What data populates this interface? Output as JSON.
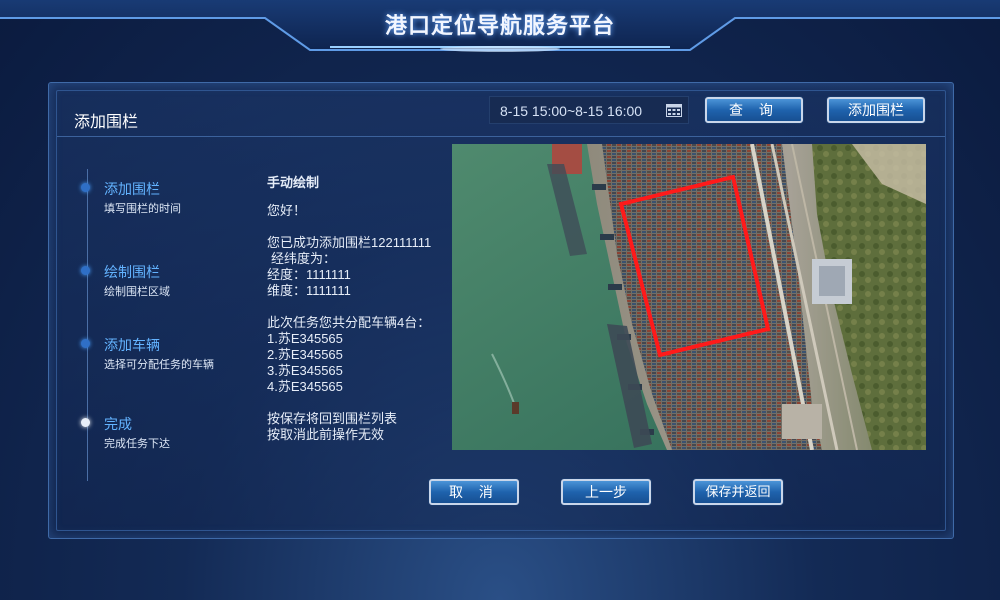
{
  "app": {
    "title": "港口定位导航服务平台"
  },
  "panel": {
    "title": "添加围栏",
    "date_range": "8-15 15:00~8-15 16:00",
    "query_label": "查 询",
    "add_fence_label": "添加围栏"
  },
  "steps": [
    {
      "title": "添加围栏",
      "subtitle": "填写围栏的时间",
      "status": "active"
    },
    {
      "title": "绘制围栏",
      "subtitle": "绘制围栏区域",
      "status": "active"
    },
    {
      "title": "添加车辆",
      "subtitle": "选择可分配任务的车辆",
      "status": "active"
    },
    {
      "title": "完成",
      "subtitle": "完成任务下达",
      "status": "current"
    }
  ],
  "message": {
    "heading": "手动绘制",
    "greeting": "您好！",
    "success": "您已成功添加围栏122111111",
    "coords_label": "经纬度为：",
    "longitude": "经度：1111111",
    "latitude": "维度：1111111",
    "assign": "此次任务您共分配车辆4台：",
    "vehicles": [
      "1.苏E345565",
      "2.苏E345565",
      "3.苏E345565",
      "4.苏E345565"
    ],
    "save_hint": "按保存将回到围栏列表",
    "cancel_hint": "按取消此前操作无效"
  },
  "actions": {
    "cancel_label": "取 消",
    "prev_label": "上一步",
    "save_label": "保存并返回"
  },
  "icons": {
    "calendar": "calendar-icon"
  },
  "colors": {
    "accent": "#63b3ff",
    "button": "#1f63ad",
    "fence": "#ff1a1a",
    "water": "#3f7c67"
  }
}
